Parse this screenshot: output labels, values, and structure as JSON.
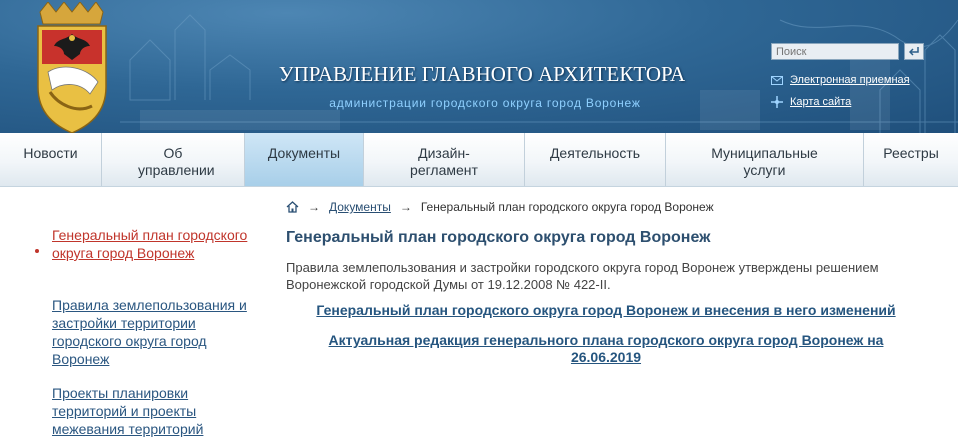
{
  "header": {
    "title": "УПРАВЛЕНИЕ ГЛАВНОГО АРХИТЕКТОРА",
    "subtitle": "администрации городского округа город Воронеж",
    "search_placeholder": "Поиск",
    "links": [
      {
        "label": "Электронная приемная",
        "icon": "envelope-icon"
      },
      {
        "label": "Карта сайта",
        "icon": "sitemap-icon"
      }
    ]
  },
  "nav": {
    "items": [
      {
        "label": "Новости"
      },
      {
        "label": "Об управлении"
      },
      {
        "label": "Документы",
        "active": true
      },
      {
        "label": "Дизайн-регламент"
      },
      {
        "label": "Деятельность"
      },
      {
        "label": "Муниципальные услуги"
      },
      {
        "label": "Реестры"
      }
    ]
  },
  "sidebar": {
    "items": [
      {
        "label": "Генеральный план городского округа город Воронеж",
        "current": true
      },
      {
        "label": "Правила землепользования и застройки территории городского округа город Воронеж"
      },
      {
        "label": "Проекты планировки территорий и проекты межевания территорий"
      }
    ]
  },
  "breadcrumb": {
    "arrow": "→",
    "items": [
      "Документы",
      "Генеральный план городского округа город Воронеж"
    ]
  },
  "main": {
    "title": "Генеральный план городского округа город Воронеж",
    "text": "Правила землепользования и застройки городского округа город Воронеж утверждены решением Воронежской городской Думы от 19.12.2008 № 422-II.",
    "links": [
      "Генеральный план городского округа город Воронеж и внесения в него изменений",
      "Актуальная редакция генерального плана городского округа город Воронеж на 26.06.2019"
    ]
  },
  "colors": {
    "header_bg": "#2f6795",
    "nav_active": "#a8cfe9",
    "link": "#25557f",
    "current_link": "#c0352b"
  }
}
